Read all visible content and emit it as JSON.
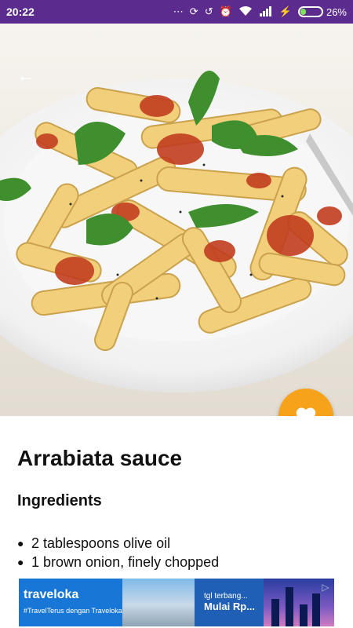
{
  "status_bar": {
    "time": "20:22",
    "battery_percent": "26%",
    "battery_level": 0.26,
    "icons": [
      "dots-icon",
      "sync-icon",
      "rotation-lock-icon",
      "alarm-icon",
      "wifi-icon",
      "signal-icon",
      "charging-icon",
      "battery-icon"
    ]
  },
  "colors": {
    "status_bar": "#5b2c8e",
    "fab": "#f6a21b",
    "ad_background": "#1877d6"
  },
  "recipe": {
    "title": "Arrabiata sauce",
    "section_title": "Ingredients",
    "ingredients": [
      "2 tablespoons olive oil",
      "1 brown onion, finely chopped"
    ]
  },
  "ad": {
    "brand": "traveloka",
    "hashtag": "#TravelTerus dengan Traveloka Poin",
    "line1": "tgl terbang...",
    "line2": "Mulai Rp..."
  }
}
